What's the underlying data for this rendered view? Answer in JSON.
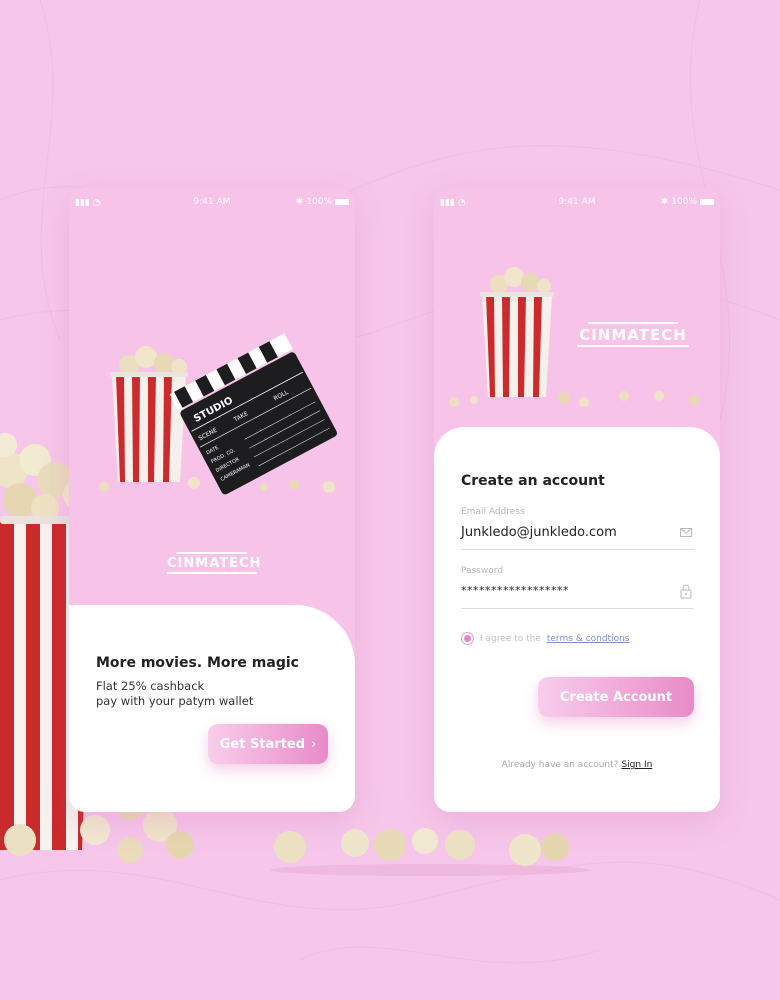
{
  "colors": {
    "background": "#f6c7ea",
    "accent": "#e88bc8",
    "link": "#7d8fd6"
  },
  "status_bar": {
    "time": "9:41 AM",
    "battery": "100%"
  },
  "brand": {
    "logo_text": "CINMATECH"
  },
  "onboarding": {
    "headline": "More movies. More magic",
    "sub_line1": "Flat 25% cashback",
    "sub_line2": "pay with your patym wallet",
    "cta_label": "Get Started",
    "clapper": {
      "title": "STUDIO",
      "col1": "SCENE",
      "col2": "TAKE",
      "col3": "ROLL",
      "rows": [
        "DATE",
        "PROD. CO.",
        "DIRECTOR",
        "CAMERAMAN"
      ]
    }
  },
  "signup": {
    "title": "Create an account",
    "email": {
      "label": "Email Address",
      "value": "Junkledo@junkledo.com",
      "icon": "mail-icon"
    },
    "password": {
      "label": "Password",
      "value": "******************",
      "icon": "lock-icon"
    },
    "agree_text": "I agree to the",
    "terms_link": "terms & condtions",
    "submit_label": "Create Account",
    "signin_prompt": "Already have an account?",
    "signin_link": "Sign In"
  }
}
